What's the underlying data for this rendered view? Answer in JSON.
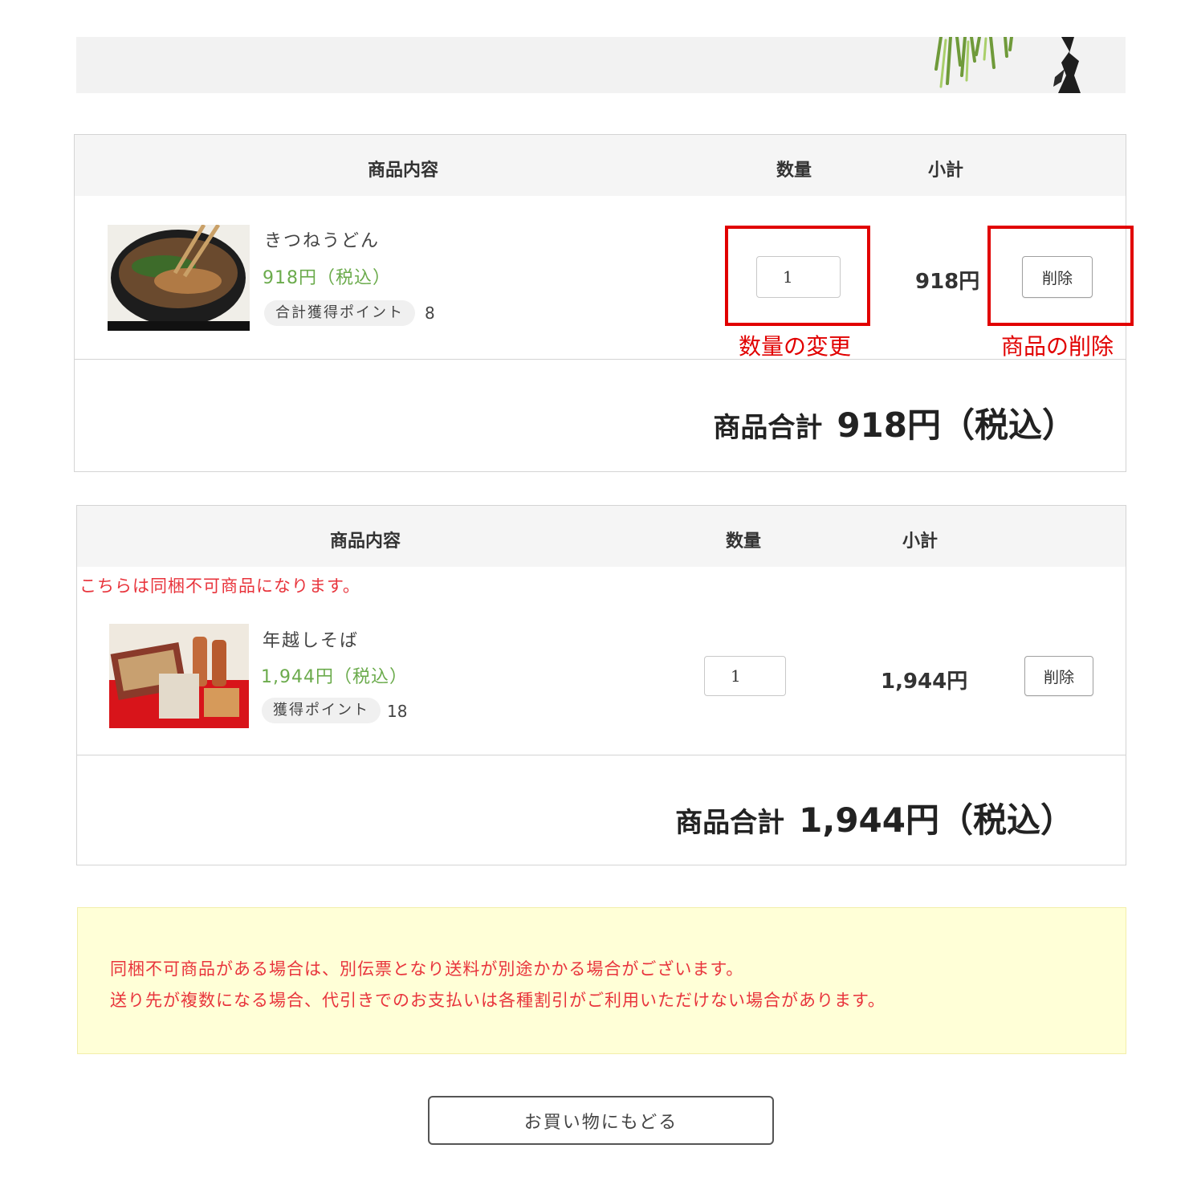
{
  "cart1": {
    "headers": {
      "product": "商品内容",
      "quantity": "数量",
      "subtotal": "小計"
    },
    "item": {
      "name": "きつねうどん",
      "price": "918円（税込）",
      "points_label": "合計獲得ポイント",
      "points": "8",
      "quantity": "1",
      "subtotal": "918円",
      "delete_label": "削除"
    },
    "total_label": "商品合計",
    "total_value": "918円（税込）"
  },
  "annotations": {
    "quantity_change": "数量の変更",
    "item_delete": "商品の削除",
    "highlight_color": "#e10000"
  },
  "cart2": {
    "headers": {
      "product": "商品内容",
      "quantity": "数量",
      "subtotal": "小計"
    },
    "warning": "こちらは同梱不可商品になります。",
    "item": {
      "name": "年越しそば",
      "price": "1,944円（税込）",
      "points_label": "獲得ポイント",
      "points": "18",
      "quantity": "1",
      "subtotal": "1,944円",
      "delete_label": "削除"
    },
    "total_label": "商品合計",
    "total_value": "1,944円（税込）"
  },
  "notice": {
    "line1": "同梱不可商品がある場合は、別伝票となり送料が別途かかる場合がございます。",
    "line2": "送り先が複数になる場合、代引きでのお支払いは各種割引がご利用いただけない場合があります。"
  },
  "back_button": "お買い物にもどる",
  "colors": {
    "price_green": "#6bab4c",
    "notice_red": "#e8343c",
    "notice_bg": "#ffffd7"
  }
}
